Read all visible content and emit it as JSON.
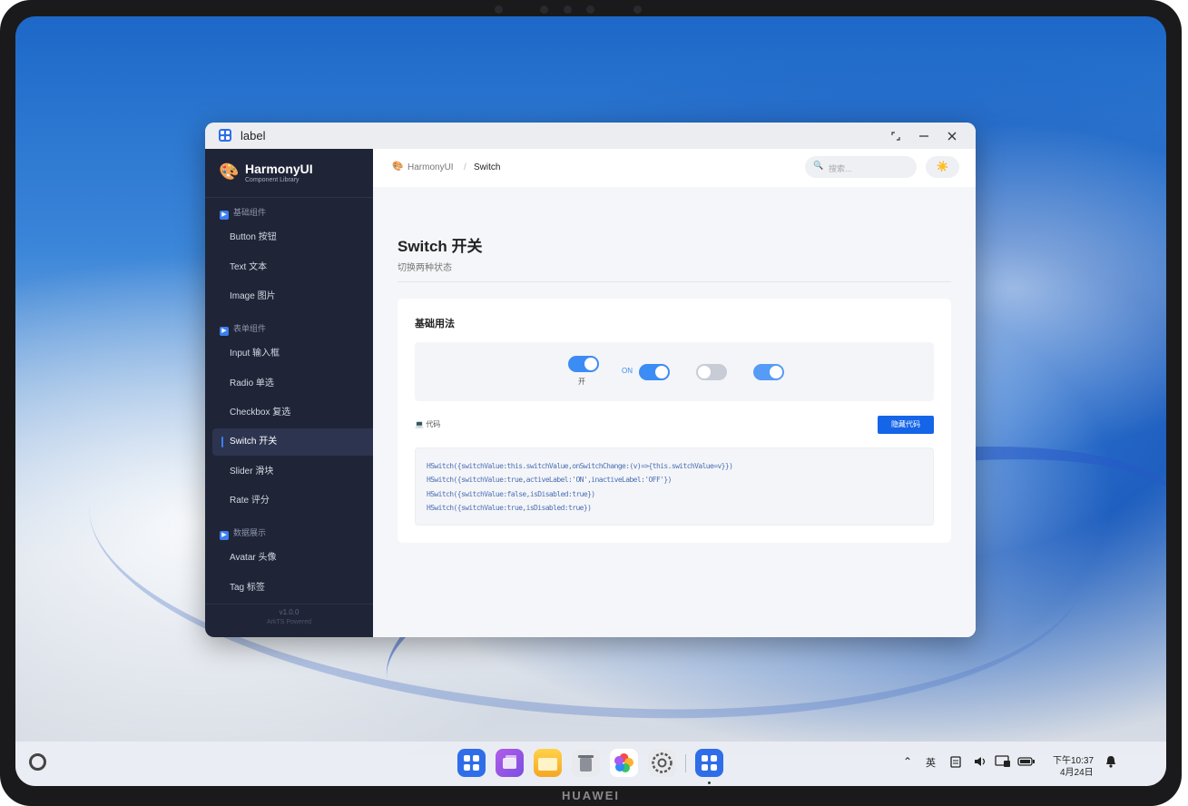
{
  "window": {
    "title": "label"
  },
  "sidebar": {
    "app_name": "HarmonyUI",
    "app_subtitle": "Component Library",
    "sections": [
      {
        "label": "基础组件",
        "items": [
          "Button 按钮",
          "Text 文本",
          "Image 图片"
        ]
      },
      {
        "label": "表单组件",
        "items": [
          "Input 输入框",
          "Radio 单选",
          "Checkbox 复选",
          "Switch 开关",
          "Slider 滑块",
          "Rate 评分"
        ]
      },
      {
        "label": "数据展示",
        "items": [
          "Avatar 头像",
          "Tag 标签"
        ]
      }
    ],
    "active_item": "Switch 开关",
    "version": "v1.0.0",
    "powered": "ArkTS Powered"
  },
  "topbar": {
    "breadcrumb_root": "HarmonyUI",
    "breadcrumb_sep": "/",
    "breadcrumb_current": "Switch",
    "search_placeholder": "搜索...",
    "theme_icon": "sun-icon"
  },
  "page": {
    "title": "Switch 开关",
    "subtitle": "切换两种状态"
  },
  "card": {
    "title": "基础用法",
    "switches": [
      {
        "checked": true,
        "disabled": false,
        "label": "开"
      },
      {
        "checked": true,
        "disabled": false,
        "active_label": "ON"
      },
      {
        "checked": false,
        "disabled": true
      },
      {
        "checked": true,
        "disabled": true
      }
    ],
    "code_label": "代码",
    "hide_code_button": "隐藏代码",
    "code_lines": [
      "HSwitch({switchValue:this.switchValue,onSwitchChange:(v)=>{this.switchValue=v}})",
      "HSwitch({switchValue:true,activeLabel:'ON',inactiveLabel:'OFF'})",
      "HSwitch({switchValue:false,isDisabled:true})",
      "HSwitch({switchValue:true,isDisabled:true})"
    ]
  },
  "taskbar": {
    "dock_apps": [
      "app-center-icon",
      "multi-window-icon",
      "files-icon",
      "trash-icon",
      "gallery-icon",
      "settings-icon",
      "harmonyui-app-icon"
    ],
    "ime": "英",
    "time": "下午10:37",
    "date": "4月24日"
  },
  "device": {
    "brand": "HUAWEI"
  }
}
